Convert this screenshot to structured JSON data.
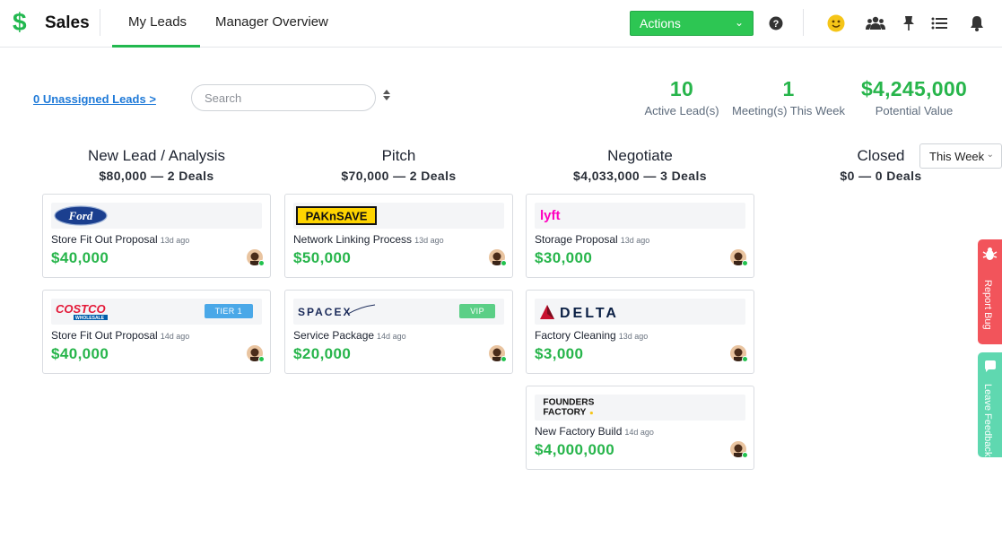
{
  "app": {
    "logo_glyph": "$",
    "title": "Sales"
  },
  "nav": {
    "tabs": [
      {
        "label": "My Leads",
        "active": true
      },
      {
        "label": "Manager Overview",
        "active": false
      }
    ]
  },
  "header": {
    "actions_label": "Actions",
    "icons": [
      "help-icon",
      "smiley-icon",
      "team-icon",
      "pin-icon",
      "list-icon",
      "bell-icon"
    ]
  },
  "toolbar": {
    "unassigned_link": "0 Unassigned Leads >",
    "search_placeholder": "Search"
  },
  "stats": [
    {
      "value": "10",
      "label": "Active Lead(s)"
    },
    {
      "value": "1",
      "label": "Meeting(s) This Week"
    },
    {
      "value": "$4,245,000",
      "label": "Potential Value"
    }
  ],
  "columns": [
    {
      "name": "New Lead / Analysis",
      "summary": "$80,000 — 2 Deals",
      "cards": [
        {
          "company_logo": "ford-logo",
          "title": "Store Fit Out Proposal",
          "ago": "13d ago",
          "amount": "$40,000"
        },
        {
          "company_logo": "costco-logo",
          "badge": "TIER 1",
          "title": "Store Fit Out Proposal",
          "ago": "14d ago",
          "amount": "$40,000"
        }
      ]
    },
    {
      "name": "Pitch",
      "summary": "$70,000 — 2 Deals",
      "cards": [
        {
          "company_logo": "paknsave-logo",
          "title": "Network Linking Process",
          "ago": "13d ago",
          "amount": "$50,000"
        },
        {
          "company_logo": "spacex-logo",
          "badge": "VIP",
          "title": "Service Package",
          "ago": "14d ago",
          "amount": "$20,000"
        }
      ]
    },
    {
      "name": "Negotiate",
      "summary": "$4,033,000 — 3 Deals",
      "cards": [
        {
          "company_logo": "lyft-logo",
          "title": "Storage Proposal",
          "ago": "13d ago",
          "amount": "$30,000"
        },
        {
          "company_logo": "delta-logo",
          "title": "Factory Cleaning",
          "ago": "13d ago",
          "amount": "$3,000"
        },
        {
          "company_logo": "founders-factory-logo",
          "title": "New Factory Build",
          "ago": "14d ago",
          "amount": "$4,000,000"
        }
      ]
    },
    {
      "name": "Closed",
      "summary": "$0 — 0 Deals",
      "filter": "This Week",
      "cards": []
    }
  ],
  "logo_text": {
    "ford": "Ford",
    "costco": "COSTCO",
    "costco_sub": "WHOLESALE",
    "paknsave": "PAKnSAVE",
    "spacex": "SPACEX",
    "lyft": "lyft",
    "delta": "DELTA",
    "founders_1": "FOUNDERS",
    "founders_2": "FACTORY"
  },
  "side_tabs": [
    {
      "label": "Report Bug",
      "color": "#f2545b"
    },
    {
      "label": "Leave Feedback",
      "color": "#5fd8b0"
    }
  ],
  "colors": {
    "brand_green": "#27b54b",
    "link_blue": "#1f7ad8",
    "tier_badge": "#4aa8e8",
    "vip_badge": "#5bcf86"
  }
}
